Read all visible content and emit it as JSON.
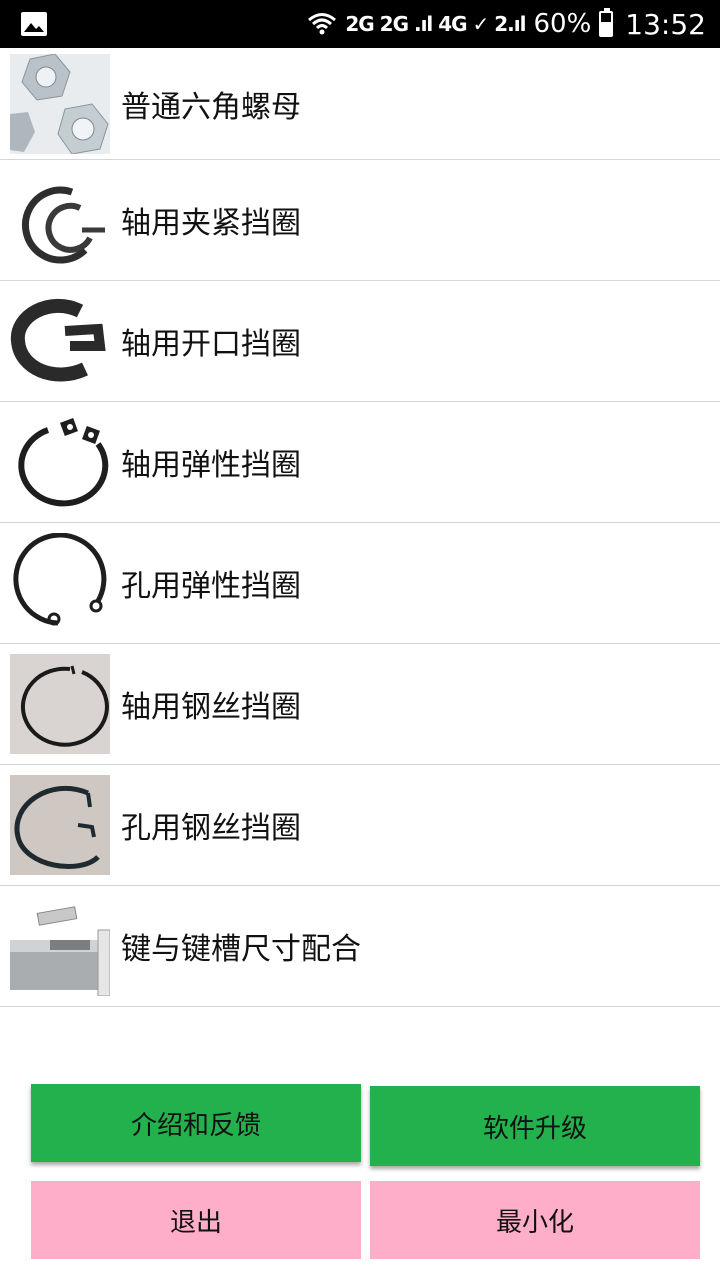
{
  "status_bar": {
    "network_label": "2G 2G .ıl 4G ✓ 2.ıl",
    "battery_percent": "60%",
    "battery_level": 0.6,
    "time": "13:52"
  },
  "items": [
    {
      "label": "普通六角螺母",
      "icon": "hex-nut-image"
    },
    {
      "label": "轴用夹紧挡圈",
      "icon": "clamp-ring-image"
    },
    {
      "label": "轴用开口挡圈",
      "icon": "e-clip-image"
    },
    {
      "label": "轴用弹性挡圈",
      "icon": "external-retaining-ring-image"
    },
    {
      "label": "孔用弹性挡圈",
      "icon": "internal-retaining-ring-image"
    },
    {
      "label": "轴用钢丝挡圈",
      "icon": "shaft-wire-ring-image"
    },
    {
      "label": "孔用钢丝挡圈",
      "icon": "bore-wire-ring-image"
    },
    {
      "label": "键与键槽尺寸配合",
      "icon": "key-and-keyway-image"
    }
  ],
  "buttons": {
    "intro": "介绍和反馈",
    "upgrade": "软件升级",
    "exit": "退出",
    "minimize": "最小化"
  },
  "colors": {
    "green_button": "#22b14c",
    "pink_button": "#ffaec9"
  }
}
